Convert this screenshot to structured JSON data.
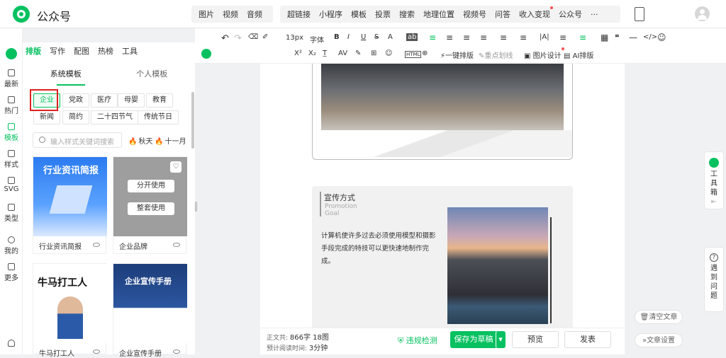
{
  "topnav": {
    "brand": "公众号",
    "group1": [
      "图片",
      "视频",
      "音频"
    ],
    "group2": [
      "超链接",
      "小程序",
      "模板",
      "投票",
      "搜索",
      "地理位置",
      "视频号",
      "问答",
      "收入变现",
      "公众号",
      "···"
    ]
  },
  "editor_toolbar": {
    "row1": [
      "13px",
      "字体",
      "B",
      "I",
      "U",
      "S",
      "A",
      "ab",
      "≡",
      "≡",
      "≡",
      "≡",
      "≡",
      "≡",
      "|A|",
      "≡",
      "≡",
      "▦",
      "❝",
      "—",
      "</>",
      "☺"
    ],
    "row2": [
      "X²",
      "X₂",
      "T̲",
      "AV",
      "✎",
      "⊞",
      "☺",
      "HTML",
      "⊕",
      "一键排版",
      "重点划线",
      "图片设计",
      "AI排版"
    ]
  },
  "left_tabs": [
    "排版",
    "写作",
    "配图",
    "热榜",
    "工具"
  ],
  "sidebar": [
    {
      "label": "最新"
    },
    {
      "label": "热门"
    },
    {
      "label": "模板"
    },
    {
      "label": "样式"
    },
    {
      "label": "SVG"
    },
    {
      "label": "类型"
    },
    {
      "label": "我的"
    },
    {
      "label": "更多"
    }
  ],
  "panel": {
    "tabs": [
      "系统模板",
      "个人模板"
    ],
    "categories": [
      "企业",
      "党政",
      "医疗",
      "母婴",
      "教育",
      "新闻",
      "简约",
      "二十四节气",
      "传统节日"
    ],
    "search_placeholder": "输入样式关键词搜索",
    "hot": [
      "秋天",
      "十一月"
    ],
    "cards": [
      {
        "title": "行业资讯简报",
        "thumb_text": "行业资讯简报"
      },
      {
        "title": "企业品牌",
        "thumb_text": "分开使用",
        "thumb_text2": "整套使用"
      },
      {
        "title": "牛马打工人",
        "thumb_text": "牛马打工人"
      },
      {
        "title": "企业宣传手册",
        "thumb_text": "企业宣传手册"
      }
    ]
  },
  "article": {
    "section_title": "宣传方式",
    "section_en_1": "Promotion",
    "section_en_2": "Goal",
    "body": "计算机使许多过去必须使用模型和摄影手段完成的特技可以更快速地制作完成。"
  },
  "footer": {
    "words_label": "正文共:",
    "words_value": "866字 18图",
    "read_label": "预计阅读时间:",
    "read_value": "3分钟",
    "check": "违规检测",
    "save": "保存为草稿",
    "preview": "预览",
    "publish": "发表"
  },
  "right": {
    "toolbox": "工具箱",
    "help": "遇到问题",
    "clear": "清空文章",
    "settings": "文章设置"
  },
  "colors": {
    "accent": "#07c160",
    "highlight": "#e02020"
  }
}
